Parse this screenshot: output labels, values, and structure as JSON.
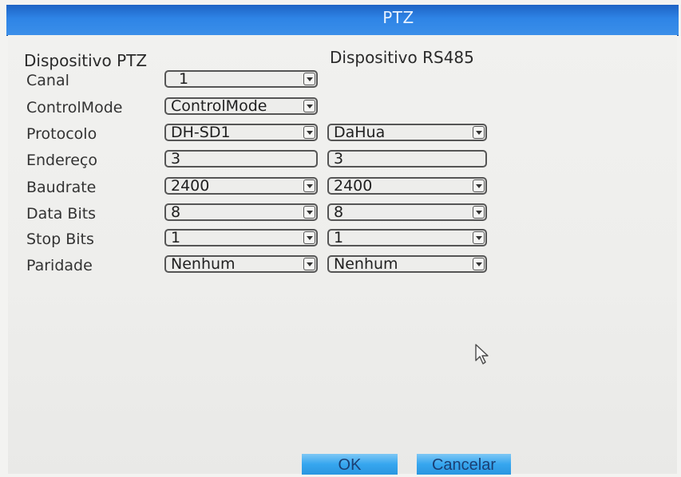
{
  "window": {
    "title": "PTZ"
  },
  "sections": {
    "ptz_device": "Dispositivo PTZ",
    "rs485_device": "Dispositivo RS485"
  },
  "rows": [
    {
      "label": "Canal",
      "ptz": "1"
    },
    {
      "label": "ControlMode",
      "ptz": "ControlMode"
    },
    {
      "label": "Protocolo",
      "ptz": "DH-SD1",
      "rs485": "DaHua"
    },
    {
      "label": "Endereço",
      "ptz": "3",
      "rs485": "3"
    },
    {
      "label": "Baudrate",
      "ptz": "2400",
      "rs485": "2400"
    },
    {
      "label": "Data Bits",
      "ptz": "8",
      "rs485": "8"
    },
    {
      "label": "Stop Bits",
      "ptz": "1",
      "rs485": "1"
    },
    {
      "label": "Paridade",
      "ptz": "Nenhum",
      "rs485": "Nenhum"
    }
  ],
  "buttons": {
    "ok": "OK",
    "cancel": "Cancelar"
  },
  "icons": {
    "dropdown": "chevron-down-icon",
    "pointer": "mouse-pointer-icon"
  },
  "colors": {
    "titlebar": "#2e84e6",
    "button": "#36a6ef",
    "panel": "#eeeeec"
  }
}
